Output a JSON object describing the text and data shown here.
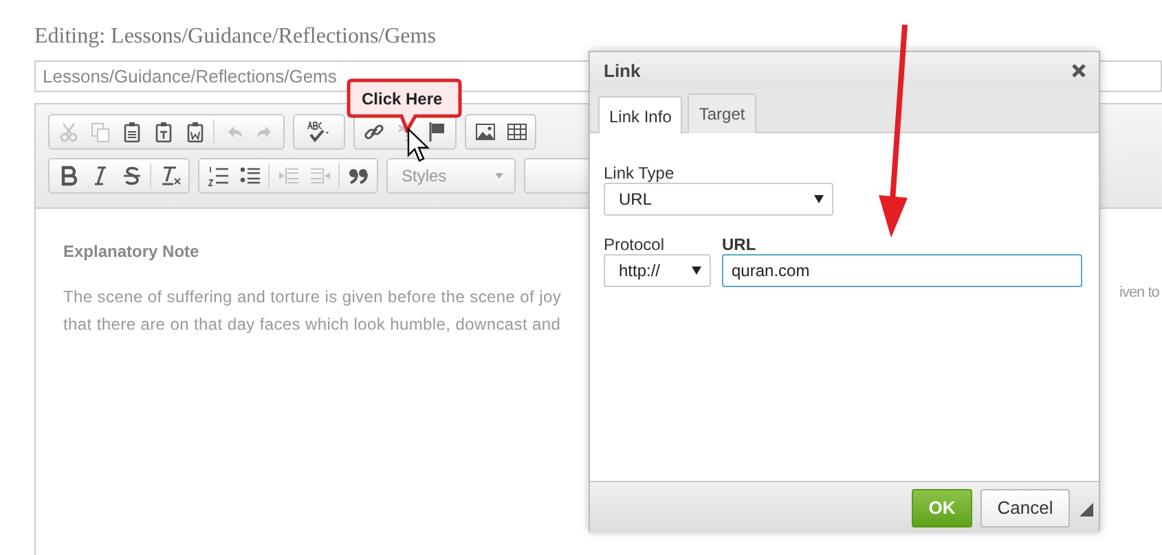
{
  "page": {
    "title": "Editing: Lessons/Guidance/Reflections/Gems",
    "path_field": {
      "value": "Lessons/Guidance/Reflections/Gems"
    }
  },
  "toolbar": {
    "rows": [
      {
        "groups": [
          {
            "buttons": [
              {
                "kind": "cut",
                "disabled": true
              },
              {
                "kind": "copy",
                "disabled": true
              },
              {
                "kind": "paste",
                "disabled": false
              },
              {
                "kind": "paste-text",
                "disabled": false
              },
              {
                "kind": "paste-word",
                "disabled": false
              },
              {
                "kind": "separator"
              },
              {
                "kind": "undo",
                "disabled": true
              },
              {
                "kind": "redo",
                "disabled": true
              }
            ]
          },
          {
            "buttons": [
              {
                "kind": "spellcheck",
                "disabled": false
              }
            ]
          },
          {
            "buttons": [
              {
                "kind": "link",
                "disabled": false
              },
              {
                "kind": "unlink",
                "disabled": true
              },
              {
                "kind": "anchor",
                "disabled": false
              }
            ]
          },
          {
            "buttons": [
              {
                "kind": "image",
                "disabled": false
              },
              {
                "kind": "table",
                "disabled": false
              }
            ]
          }
        ]
      },
      {
        "groups": [
          {
            "buttons": [
              {
                "kind": "bold",
                "disabled": false
              },
              {
                "kind": "italic",
                "disabled": false
              },
              {
                "kind": "strike",
                "disabled": false
              },
              {
                "kind": "separator"
              },
              {
                "kind": "clear-format",
                "disabled": false
              }
            ]
          },
          {
            "buttons": [
              {
                "kind": "numbered-list",
                "disabled": false
              },
              {
                "kind": "bulleted-list",
                "disabled": false
              },
              {
                "kind": "separator"
              },
              {
                "kind": "outdent",
                "disabled": true
              },
              {
                "kind": "indent",
                "disabled": true
              },
              {
                "kind": "separator"
              },
              {
                "kind": "blockquote",
                "disabled": false
              }
            ]
          },
          {
            "buttons": [
              {
                "kind": "combo",
                "label": "Styles",
                "disabled": false
              }
            ]
          }
        ]
      }
    ]
  },
  "callout": {
    "text": "Click Here"
  },
  "editor": {
    "heading": "Explanatory Note",
    "lines": [
      "The scene of suffering and torture is given before the scene of joy",
      "that there are on that day faces which look humble, downcast and"
    ],
    "hidden_line_end": "iven to"
  },
  "dialog": {
    "title": "Link",
    "tabs": [
      {
        "label": "Link Info",
        "selected": true
      },
      {
        "label": "Target",
        "selected": false
      }
    ],
    "link_type": {
      "label": "Link Type",
      "value": "URL"
    },
    "protocol": {
      "label": "Protocol",
      "value": "http://"
    },
    "url": {
      "label": "URL",
      "value": "quran.com"
    },
    "buttons": [
      {
        "label": "OK",
        "kind": "primary"
      },
      {
        "label": "Cancel",
        "kind": "secondary"
      }
    ]
  }
}
